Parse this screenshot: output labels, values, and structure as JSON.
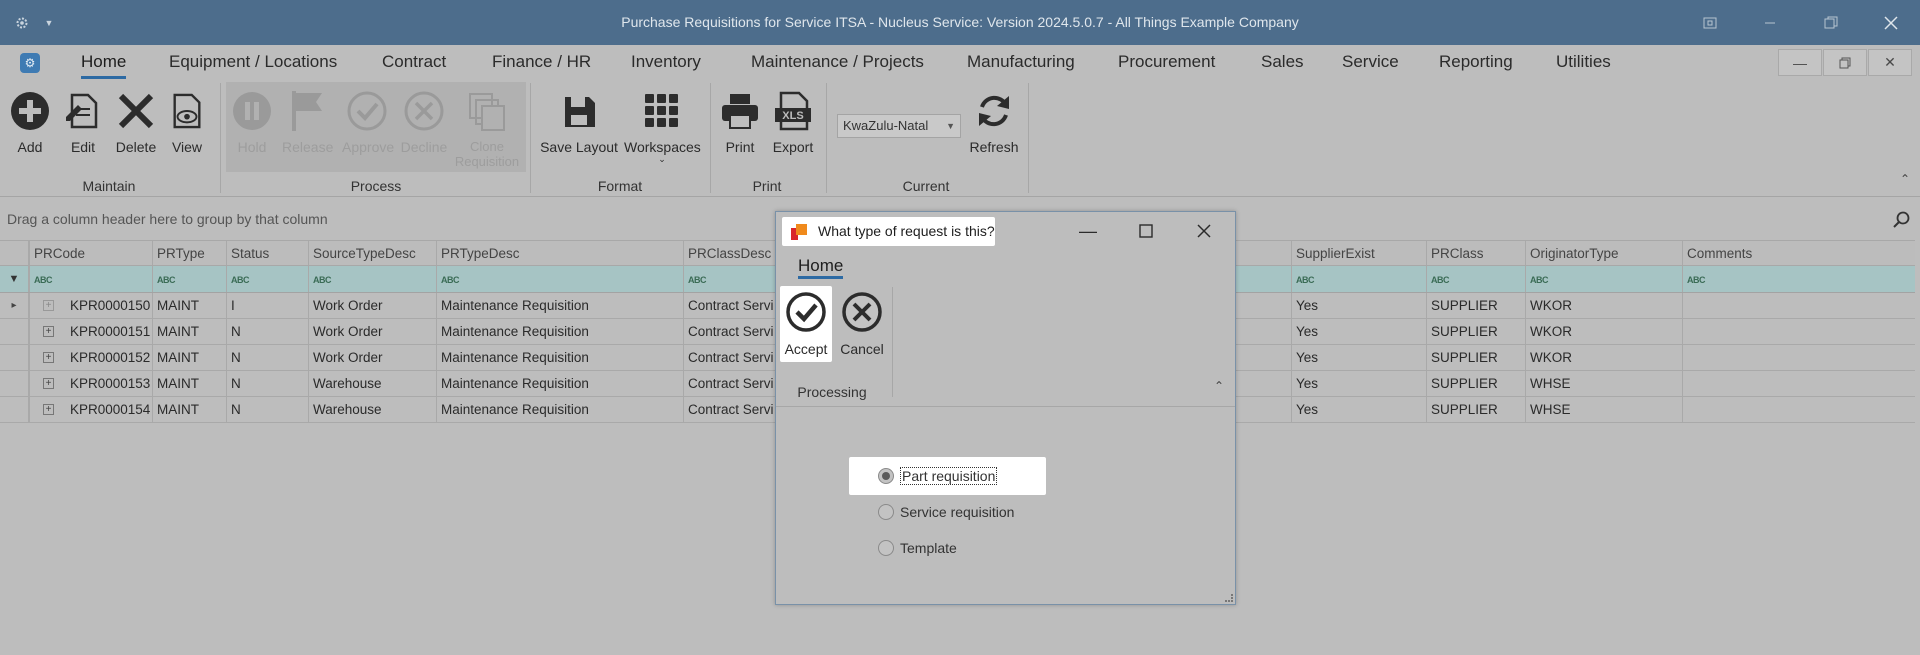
{
  "window": {
    "title": "Purchase Requisitions for Service ITSA - Nucleus Service: Version 2024.5.0.7 - All Things Example Company"
  },
  "menu": {
    "tabs": [
      {
        "label": "Home"
      },
      {
        "label": "Equipment / Locations"
      },
      {
        "label": "Contract"
      },
      {
        "label": "Finance / HR"
      },
      {
        "label": "Inventory"
      },
      {
        "label": "Maintenance / Projects"
      },
      {
        "label": "Manufacturing"
      },
      {
        "label": "Procurement"
      },
      {
        "label": "Sales"
      },
      {
        "label": "Service"
      },
      {
        "label": "Reporting"
      },
      {
        "label": "Utilities"
      }
    ]
  },
  "ribbon": {
    "maintain": {
      "add": "Add",
      "edit": "Edit",
      "delete": "Delete",
      "view": "View",
      "group": "Maintain"
    },
    "process": {
      "hold": "Hold",
      "release": "Release",
      "approve": "Approve",
      "decline": "Decline",
      "clone": "Clone Requisition",
      "group": "Process"
    },
    "format": {
      "save_layout": "Save Layout",
      "workspaces": "Workspaces",
      "group": "Format"
    },
    "print": {
      "print": "Print",
      "export": "Export",
      "group": "Print"
    },
    "current": {
      "region": "KwaZulu-Natal",
      "refresh": "Refresh",
      "group": "Current"
    }
  },
  "grid": {
    "group_hint": "Drag a column header here to group by that column",
    "columns": [
      "PRCode",
      "PRType",
      "Status",
      "SourceTypeDesc",
      "PRTypeDesc",
      "PRClassDesc",
      "SupplierExist",
      "PRClass",
      "OriginatorType",
      "Comments"
    ],
    "filter_glyph": "ABC",
    "rows": [
      {
        "code": "KPR0000150",
        "type": "MAINT",
        "status": "I",
        "source": "Work Order",
        "prtype": "Maintenance Requisition",
        "classdesc": "Contract Servi",
        "supplier": "Yes",
        "prclass": "SUPPLIER",
        "originator": "WKOR"
      },
      {
        "code": "KPR0000151",
        "type": "MAINT",
        "status": "N",
        "source": "Work Order",
        "prtype": "Maintenance Requisition",
        "classdesc": "Contract Servi",
        "supplier": "Yes",
        "prclass": "SUPPLIER",
        "originator": "WKOR"
      },
      {
        "code": "KPR0000152",
        "type": "MAINT",
        "status": "N",
        "source": "Work Order",
        "prtype": "Maintenance Requisition",
        "classdesc": "Contract Servi",
        "supplier": "Yes",
        "prclass": "SUPPLIER",
        "originator": "WKOR"
      },
      {
        "code": "KPR0000153",
        "type": "MAINT",
        "status": "N",
        "source": "Warehouse",
        "prtype": "Maintenance Requisition",
        "classdesc": "Contract Servi",
        "supplier": "Yes",
        "prclass": "SUPPLIER",
        "originator": "WHSE"
      },
      {
        "code": "KPR0000154",
        "type": "MAINT",
        "status": "N",
        "source": "Warehouse",
        "prtype": "Maintenance Requisition",
        "classdesc": "Contract Servi",
        "supplier": "Yes",
        "prclass": "SUPPLIER",
        "originator": "WHSE"
      }
    ]
  },
  "dialog": {
    "title": "What type of request is this?",
    "tab": "Home",
    "accept": "Accept",
    "cancel": "Cancel",
    "group": "Processing",
    "options": [
      {
        "label": "Part requisition",
        "selected": true
      },
      {
        "label": "Service requisition",
        "selected": false
      },
      {
        "label": "Template",
        "selected": false
      }
    ]
  },
  "colors": {
    "titlebar": "#4d6d8c",
    "accent": "#2d6aa3",
    "filter_row": "#a6c4c4"
  },
  "icons": [
    "gear-icon",
    "chevron-down-icon",
    "restore-icon",
    "minimize-icon",
    "maximize-icon",
    "close-icon",
    "add-icon",
    "edit-icon",
    "delete-icon",
    "view-icon",
    "hold-icon",
    "flag-icon",
    "approve-icon",
    "decline-icon",
    "clone-icon",
    "save-layout-icon",
    "workspaces-icon",
    "print-icon",
    "export-xls-icon",
    "refresh-icon",
    "search-icon",
    "filter-icon",
    "collapse-ribbon-icon"
  ]
}
